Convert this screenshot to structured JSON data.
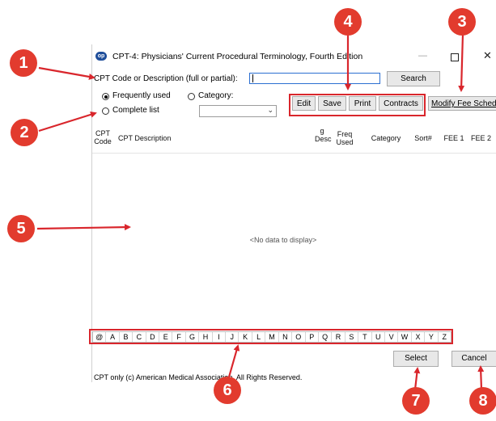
{
  "window": {
    "title": "CPT-4:  Physicians' Current Procedural Terminology, Fourth Edition",
    "min_glyph": "—",
    "close_glyph": "✕"
  },
  "search": {
    "label": "CPT Code or Description (full or partial):",
    "value": "",
    "button": "Search"
  },
  "filter": {
    "frequently_used": "Frequently used",
    "complete_list": "Complete list",
    "category": "Category:",
    "selected": "frequently_used",
    "category_value": ""
  },
  "toolbar": {
    "edit": "Edit",
    "save": "Save",
    "print": "Print",
    "contracts": "Contracts",
    "modify_fee": "Modify Fee Schedule"
  },
  "table": {
    "columns": {
      "cpt_code": "CPT Code",
      "description": "CPT Description",
      "g_desc": "g Desc",
      "freq_used": "Freq Used",
      "category": "Category",
      "sort": "Sort#",
      "fee1": "FEE 1",
      "fee2": "FEE 2"
    },
    "empty_text": "<No data to display>"
  },
  "alphabet": [
    "@",
    "A",
    "B",
    "C",
    "D",
    "E",
    "F",
    "G",
    "H",
    "I",
    "J",
    "K",
    "L",
    "M",
    "N",
    "O",
    "P",
    "Q",
    "R",
    "S",
    "T",
    "U",
    "V",
    "W",
    "X",
    "Y",
    "Z"
  ],
  "actions": {
    "select": "Select",
    "cancel": "Cancel"
  },
  "footer": "CPT only (c) American Medical Association. All Rights Reserved.",
  "annotations": [
    "1",
    "2",
    "3",
    "4",
    "5",
    "6",
    "7",
    "8"
  ],
  "colors": {
    "annotation_red": "#d9262c",
    "badge_red": "#e23b2e",
    "input_focus": "#2b6fd1"
  }
}
